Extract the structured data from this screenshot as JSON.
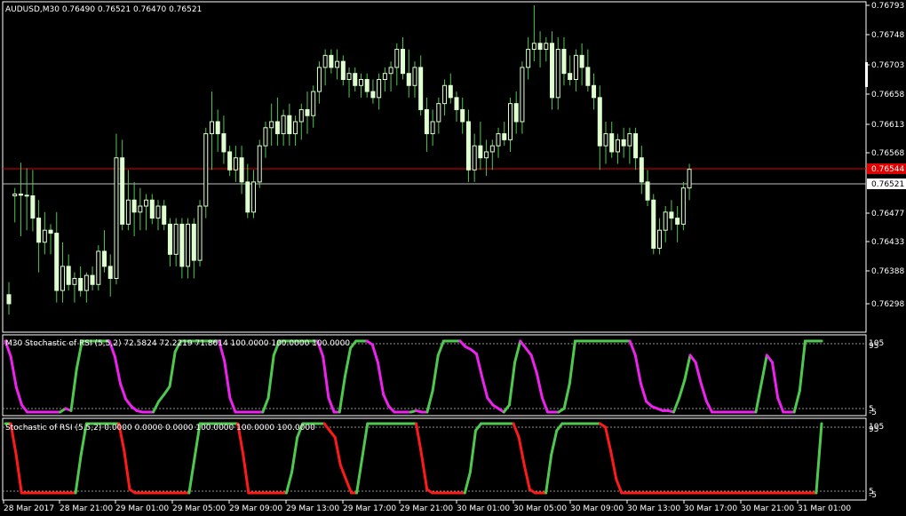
{
  "main": {
    "header": "AUDUSD,M30  0.76490 0.76521 0.76470 0.76521",
    "price_axis": [
      "0.76793",
      "0.76748",
      "0.76703",
      "0.76658",
      "0.76613",
      "0.76568",
      "0.76477",
      "0.76433",
      "0.76388",
      "0.76298"
    ],
    "red_line_label": "0.76544",
    "bid_line_label": "0.76521",
    "colors": {
      "bull": "#dfffd0",
      "bear": "#dfffd0",
      "wick": "#4ec94e",
      "red_line": "#e00000",
      "bid_line": "#c0c0c0"
    }
  },
  "panel1": {
    "header": "M30 Stochastic of RSI (5,5,2) 72.5824 72.2219 71.8614 100.0000 100.0000 100.0000",
    "axis_top": "105",
    "axis_top2": "95",
    "axis_bottom": "5",
    "axis_bottom2": "-5",
    "colors": {
      "up": "#4ec94e",
      "down": "#ee22ee"
    }
  },
  "panel2": {
    "header": "Stochastic of RSI (5,5,2) 0.0000 0.0000 0.0000 100.0000 100.0000 100.0000",
    "axis_top": "105",
    "axis_top2": "95",
    "axis_bottom": "5",
    "axis_bottom2": "-5",
    "colors": {
      "up": "#4ec94e",
      "down": "#ff1a1a"
    }
  },
  "time_axis": [
    "28 Mar 2017",
    "28 Mar 21:00",
    "29 Mar 01:00",
    "29 Mar 05:00",
    "29 Mar 09:00",
    "29 Mar 13:00",
    "29 Mar 17:00",
    "29 Mar 21:00",
    "30 Mar 01:00",
    "30 Mar 05:00",
    "30 Mar 09:00",
    "30 Mar 13:00",
    "30 Mar 17:00",
    "30 Mar 21:00",
    "31 Mar 01:00"
  ],
  "chart_data": {
    "type": "candlestick",
    "candles": [
      {
        "o": 0.76313,
        "h": 0.76334,
        "l": 0.7628,
        "c": 0.76298
      },
      {
        "o": 0.76477,
        "h": 0.7649,
        "l": 0.76433,
        "c": 0.7648
      },
      {
        "o": 0.7648,
        "h": 0.76532,
        "l": 0.7641,
        "c": 0.76478
      },
      {
        "o": 0.76478,
        "h": 0.76523,
        "l": 0.7642,
        "c": 0.76477
      },
      {
        "o": 0.76477,
        "h": 0.7652,
        "l": 0.76418,
        "c": 0.7644
      },
      {
        "o": 0.7644,
        "h": 0.7647,
        "l": 0.7635,
        "c": 0.764
      },
      {
        "o": 0.764,
        "h": 0.7645,
        "l": 0.7638,
        "c": 0.7642
      },
      {
        "o": 0.7642,
        "h": 0.7643,
        "l": 0.7638,
        "c": 0.76415
      },
      {
        "o": 0.76415,
        "h": 0.7645,
        "l": 0.763,
        "c": 0.7632
      },
      {
        "o": 0.7632,
        "h": 0.764,
        "l": 0.763,
        "c": 0.7636
      },
      {
        "o": 0.7636,
        "h": 0.7638,
        "l": 0.7632,
        "c": 0.7633
      },
      {
        "o": 0.7633,
        "h": 0.7635,
        "l": 0.763,
        "c": 0.7634
      },
      {
        "o": 0.7634,
        "h": 0.7636,
        "l": 0.7631,
        "c": 0.7632
      },
      {
        "o": 0.7632,
        "h": 0.7635,
        "l": 0.763,
        "c": 0.76345
      },
      {
        "o": 0.76345,
        "h": 0.7636,
        "l": 0.7632,
        "c": 0.7633
      },
      {
        "o": 0.7633,
        "h": 0.76395,
        "l": 0.7632,
        "c": 0.76385
      },
      {
        "o": 0.76385,
        "h": 0.7642,
        "l": 0.7635,
        "c": 0.7636
      },
      {
        "o": 0.7636,
        "h": 0.7638,
        "l": 0.7631,
        "c": 0.7634
      },
      {
        "o": 0.7634,
        "h": 0.7658,
        "l": 0.7633,
        "c": 0.7654
      },
      {
        "o": 0.7654,
        "h": 0.7657,
        "l": 0.7642,
        "c": 0.7643
      },
      {
        "o": 0.7643,
        "h": 0.7652,
        "l": 0.7642,
        "c": 0.7647
      },
      {
        "o": 0.7647,
        "h": 0.765,
        "l": 0.7641,
        "c": 0.7645
      },
      {
        "o": 0.7645,
        "h": 0.7649,
        "l": 0.7642,
        "c": 0.7646
      },
      {
        "o": 0.7646,
        "h": 0.7648,
        "l": 0.7642,
        "c": 0.7647
      },
      {
        "o": 0.7647,
        "h": 0.7648,
        "l": 0.7643,
        "c": 0.7644
      },
      {
        "o": 0.7644,
        "h": 0.7647,
        "l": 0.7642,
        "c": 0.7646
      },
      {
        "o": 0.7646,
        "h": 0.7647,
        "l": 0.7642,
        "c": 0.7643
      },
      {
        "o": 0.7643,
        "h": 0.7644,
        "l": 0.7636,
        "c": 0.7638
      },
      {
        "o": 0.7638,
        "h": 0.7644,
        "l": 0.7636,
        "c": 0.7643
      },
      {
        "o": 0.7643,
        "h": 0.7644,
        "l": 0.7634,
        "c": 0.7636
      },
      {
        "o": 0.7636,
        "h": 0.7644,
        "l": 0.7634,
        "c": 0.7643
      },
      {
        "o": 0.7643,
        "h": 0.7644,
        "l": 0.7634,
        "c": 0.7637
      },
      {
        "o": 0.7637,
        "h": 0.7647,
        "l": 0.7636,
        "c": 0.7646
      },
      {
        "o": 0.7646,
        "h": 0.7659,
        "l": 0.7644,
        "c": 0.7658
      },
      {
        "o": 0.7658,
        "h": 0.7665,
        "l": 0.7652,
        "c": 0.766
      },
      {
        "o": 0.766,
        "h": 0.7662,
        "l": 0.7655,
        "c": 0.7658
      },
      {
        "o": 0.7658,
        "h": 0.7661,
        "l": 0.7653,
        "c": 0.7655
      },
      {
        "o": 0.7655,
        "h": 0.7656,
        "l": 0.7651,
        "c": 0.7652
      },
      {
        "o": 0.7652,
        "h": 0.7656,
        "l": 0.765,
        "c": 0.7654
      },
      {
        "o": 0.7654,
        "h": 0.7656,
        "l": 0.7648,
        "c": 0.765
      },
      {
        "o": 0.765,
        "h": 0.7653,
        "l": 0.7644,
        "c": 0.7645
      },
      {
        "o": 0.7645,
        "h": 0.7652,
        "l": 0.7644,
        "c": 0.765
      },
      {
        "o": 0.765,
        "h": 0.7657,
        "l": 0.7649,
        "c": 0.7656
      },
      {
        "o": 0.7656,
        "h": 0.766,
        "l": 0.7654,
        "c": 0.7659
      },
      {
        "o": 0.7659,
        "h": 0.7663,
        "l": 0.7656,
        "c": 0.766
      },
      {
        "o": 0.766,
        "h": 0.7664,
        "l": 0.7656,
        "c": 0.7658
      },
      {
        "o": 0.7658,
        "h": 0.7662,
        "l": 0.7656,
        "c": 0.7661
      },
      {
        "o": 0.7661,
        "h": 0.7663,
        "l": 0.7656,
        "c": 0.7658
      },
      {
        "o": 0.7658,
        "h": 0.7661,
        "l": 0.7656,
        "c": 0.766
      },
      {
        "o": 0.766,
        "h": 0.7663,
        "l": 0.7657,
        "c": 0.7662
      },
      {
        "o": 0.7662,
        "h": 0.7665,
        "l": 0.7658,
        "c": 0.7661
      },
      {
        "o": 0.7661,
        "h": 0.7666,
        "l": 0.7659,
        "c": 0.7665
      },
      {
        "o": 0.7665,
        "h": 0.767,
        "l": 0.7663,
        "c": 0.7669
      },
      {
        "o": 0.7669,
        "h": 0.7672,
        "l": 0.7666,
        "c": 0.7671
      },
      {
        "o": 0.7671,
        "h": 0.7672,
        "l": 0.7668,
        "c": 0.7669
      },
      {
        "o": 0.7669,
        "h": 0.7672,
        "l": 0.7667,
        "c": 0.767
      },
      {
        "o": 0.767,
        "h": 0.7671,
        "l": 0.7666,
        "c": 0.7667
      },
      {
        "o": 0.7667,
        "h": 0.7669,
        "l": 0.7664,
        "c": 0.7668
      },
      {
        "o": 0.7668,
        "h": 0.7669,
        "l": 0.7665,
        "c": 0.7666
      },
      {
        "o": 0.7666,
        "h": 0.7668,
        "l": 0.7664,
        "c": 0.7667
      },
      {
        "o": 0.7667,
        "h": 0.7668,
        "l": 0.7664,
        "c": 0.7665
      },
      {
        "o": 0.7665,
        "h": 0.7667,
        "l": 0.7663,
        "c": 0.7664
      },
      {
        "o": 0.7664,
        "h": 0.7668,
        "l": 0.7662,
        "c": 0.7667
      },
      {
        "o": 0.7667,
        "h": 0.7669,
        "l": 0.7665,
        "c": 0.7668
      },
      {
        "o": 0.7668,
        "h": 0.767,
        "l": 0.7665,
        "c": 0.7669
      },
      {
        "o": 0.7669,
        "h": 0.7673,
        "l": 0.7666,
        "c": 0.7672
      },
      {
        "o": 0.7672,
        "h": 0.7674,
        "l": 0.7667,
        "c": 0.7668
      },
      {
        "o": 0.7668,
        "h": 0.7672,
        "l": 0.7664,
        "c": 0.7666
      },
      {
        "o": 0.7666,
        "h": 0.767,
        "l": 0.7664,
        "c": 0.7669
      },
      {
        "o": 0.7669,
        "h": 0.7671,
        "l": 0.7661,
        "c": 0.7662
      },
      {
        "o": 0.7662,
        "h": 0.7664,
        "l": 0.7655,
        "c": 0.7658
      },
      {
        "o": 0.7658,
        "h": 0.7662,
        "l": 0.7656,
        "c": 0.766
      },
      {
        "o": 0.766,
        "h": 0.7664,
        "l": 0.7658,
        "c": 0.7663
      },
      {
        "o": 0.7663,
        "h": 0.7667,
        "l": 0.7661,
        "c": 0.7666
      },
      {
        "o": 0.7666,
        "h": 0.7668,
        "l": 0.7663,
        "c": 0.7664
      },
      {
        "o": 0.7664,
        "h": 0.7665,
        "l": 0.766,
        "c": 0.7662
      },
      {
        "o": 0.7662,
        "h": 0.7664,
        "l": 0.7658,
        "c": 0.766
      },
      {
        "o": 0.766,
        "h": 0.7662,
        "l": 0.765,
        "c": 0.7652
      },
      {
        "o": 0.7652,
        "h": 0.7658,
        "l": 0.765,
        "c": 0.7656
      },
      {
        "o": 0.7656,
        "h": 0.766,
        "l": 0.7652,
        "c": 0.7654
      },
      {
        "o": 0.7654,
        "h": 0.7657,
        "l": 0.7651,
        "c": 0.7655
      },
      {
        "o": 0.7655,
        "h": 0.7657,
        "l": 0.7652,
        "c": 0.7656
      },
      {
        "o": 0.7656,
        "h": 0.7659,
        "l": 0.7654,
        "c": 0.7658
      },
      {
        "o": 0.7658,
        "h": 0.766,
        "l": 0.7656,
        "c": 0.7657
      },
      {
        "o": 0.7657,
        "h": 0.7664,
        "l": 0.7655,
        "c": 0.7663
      },
      {
        "o": 0.7663,
        "h": 0.7665,
        "l": 0.7658,
        "c": 0.766
      },
      {
        "o": 0.766,
        "h": 0.767,
        "l": 0.7658,
        "c": 0.7669
      },
      {
        "o": 0.7669,
        "h": 0.7674,
        "l": 0.7667,
        "c": 0.7672
      },
      {
        "o": 0.7672,
        "h": 0.76793,
        "l": 0.767,
        "c": 0.7673
      },
      {
        "o": 0.7673,
        "h": 0.7675,
        "l": 0.7669,
        "c": 0.7672
      },
      {
        "o": 0.7672,
        "h": 0.7674,
        "l": 0.767,
        "c": 0.7673
      },
      {
        "o": 0.7673,
        "h": 0.7675,
        "l": 0.7662,
        "c": 0.7664
      },
      {
        "o": 0.7664,
        "h": 0.7674,
        "l": 0.7662,
        "c": 0.7672
      },
      {
        "o": 0.7672,
        "h": 0.7674,
        "l": 0.7666,
        "c": 0.7668
      },
      {
        "o": 0.7668,
        "h": 0.7671,
        "l": 0.7666,
        "c": 0.7667
      },
      {
        "o": 0.7667,
        "h": 0.7672,
        "l": 0.7665,
        "c": 0.7671
      },
      {
        "o": 0.7671,
        "h": 0.7673,
        "l": 0.7666,
        "c": 0.7669
      },
      {
        "o": 0.7669,
        "h": 0.7672,
        "l": 0.7665,
        "c": 0.7666
      },
      {
        "o": 0.7666,
        "h": 0.7668,
        "l": 0.7662,
        "c": 0.7664
      },
      {
        "o": 0.7664,
        "h": 0.7666,
        "l": 0.7652,
        "c": 0.7656
      },
      {
        "o": 0.7656,
        "h": 0.766,
        "l": 0.7653,
        "c": 0.7658
      },
      {
        "o": 0.7658,
        "h": 0.766,
        "l": 0.7654,
        "c": 0.7655
      },
      {
        "o": 0.7655,
        "h": 0.7658,
        "l": 0.7653,
        "c": 0.7657
      },
      {
        "o": 0.7657,
        "h": 0.7659,
        "l": 0.7654,
        "c": 0.7656
      },
      {
        "o": 0.7656,
        "h": 0.7659,
        "l": 0.7653,
        "c": 0.7658
      },
      {
        "o": 0.7658,
        "h": 0.7659,
        "l": 0.7652,
        "c": 0.7654
      },
      {
        "o": 0.7654,
        "h": 0.7656,
        "l": 0.7648,
        "c": 0.765
      },
      {
        "o": 0.765,
        "h": 0.7652,
        "l": 0.7646,
        "c": 0.7647
      },
      {
        "o": 0.7647,
        "h": 0.7648,
        "l": 0.7638,
        "c": 0.7639
      },
      {
        "o": 0.7639,
        "h": 0.7644,
        "l": 0.7638,
        "c": 0.7642
      },
      {
        "o": 0.7642,
        "h": 0.7646,
        "l": 0.764,
        "c": 0.7645
      },
      {
        "o": 0.7645,
        "h": 0.7647,
        "l": 0.7642,
        "c": 0.7644
      },
      {
        "o": 0.7644,
        "h": 0.7646,
        "l": 0.764,
        "c": 0.7643
      },
      {
        "o": 0.7643,
        "h": 0.765,
        "l": 0.7642,
        "c": 0.7649
      },
      {
        "o": 0.7649,
        "h": 0.7653,
        "l": 0.7647,
        "c": 0.76521
      }
    ],
    "stoch1": [
      100,
      78,
      35,
      10,
      0,
      0,
      0,
      0,
      0,
      0,
      0,
      5,
      2,
      60,
      100,
      100,
      100,
      100,
      100,
      100,
      78,
      40,
      18,
      8,
      2,
      0,
      0,
      0,
      15,
      25,
      36,
      85,
      100,
      100,
      100,
      100,
      100,
      100,
      100,
      100,
      72,
      20,
      0,
      0,
      0,
      0,
      0,
      0,
      20,
      80,
      100,
      100,
      100,
      100,
      100,
      100,
      100,
      100,
      78,
      20,
      0,
      0,
      50,
      90,
      100,
      100,
      100,
      95,
      70,
      25,
      8,
      0,
      0,
      0,
      0,
      2,
      0,
      0,
      30,
      80,
      100,
      100,
      100,
      100,
      92,
      88,
      82,
      50,
      20,
      10,
      5,
      0,
      10,
      70,
      100,
      90,
      80,
      55,
      20,
      0,
      0,
      0,
      5,
      40,
      100,
      100,
      100,
      100,
      100,
      100,
      100,
      100,
      100,
      100,
      100,
      80,
      40,
      15,
      8,
      5,
      2,
      2,
      0,
      20,
      45,
      80,
      70,
      40,
      15,
      0,
      0,
      0,
      0,
      0,
      0,
      0,
      0,
      0,
      40,
      80,
      70,
      20,
      0,
      0,
      0,
      30,
      100,
      100,
      100,
      100
    ],
    "stoch2": [
      100,
      100,
      55,
      0,
      0,
      0,
      0,
      0,
      0,
      0,
      0,
      0,
      0,
      0,
      55,
      100,
      100,
      100,
      100,
      100,
      100,
      100,
      60,
      5,
      0,
      0,
      0,
      0,
      0,
      0,
      0,
      0,
      0,
      0,
      0,
      50,
      100,
      100,
      100,
      100,
      100,
      100,
      100,
      100,
      55,
      0,
      0,
      0,
      0,
      0,
      0,
      0,
      0,
      30,
      80,
      100,
      100,
      100,
      100,
      100,
      90,
      80,
      40,
      20,
      0,
      0,
      50,
      100,
      100,
      100,
      100,
      100,
      100,
      100,
      100,
      100,
      100,
      55,
      5,
      0,
      0,
      0,
      0,
      0,
      0,
      0,
      30,
      90,
      100,
      100,
      100,
      100,
      100,
      100,
      100,
      80,
      40,
      5,
      0,
      0,
      0,
      55,
      90,
      100,
      100,
      100,
      100,
      100,
      100,
      100,
      100,
      95,
      60,
      20,
      0,
      0,
      0,
      0,
      0,
      0,
      0,
      0,
      0,
      0,
      0,
      0,
      0,
      0,
      0,
      0,
      0,
      0,
      0,
      0,
      0,
      0,
      0,
      0,
      0,
      0,
      0,
      0,
      0,
      0,
      0,
      0,
      0,
      0,
      0,
      0,
      0,
      100
    ]
  }
}
